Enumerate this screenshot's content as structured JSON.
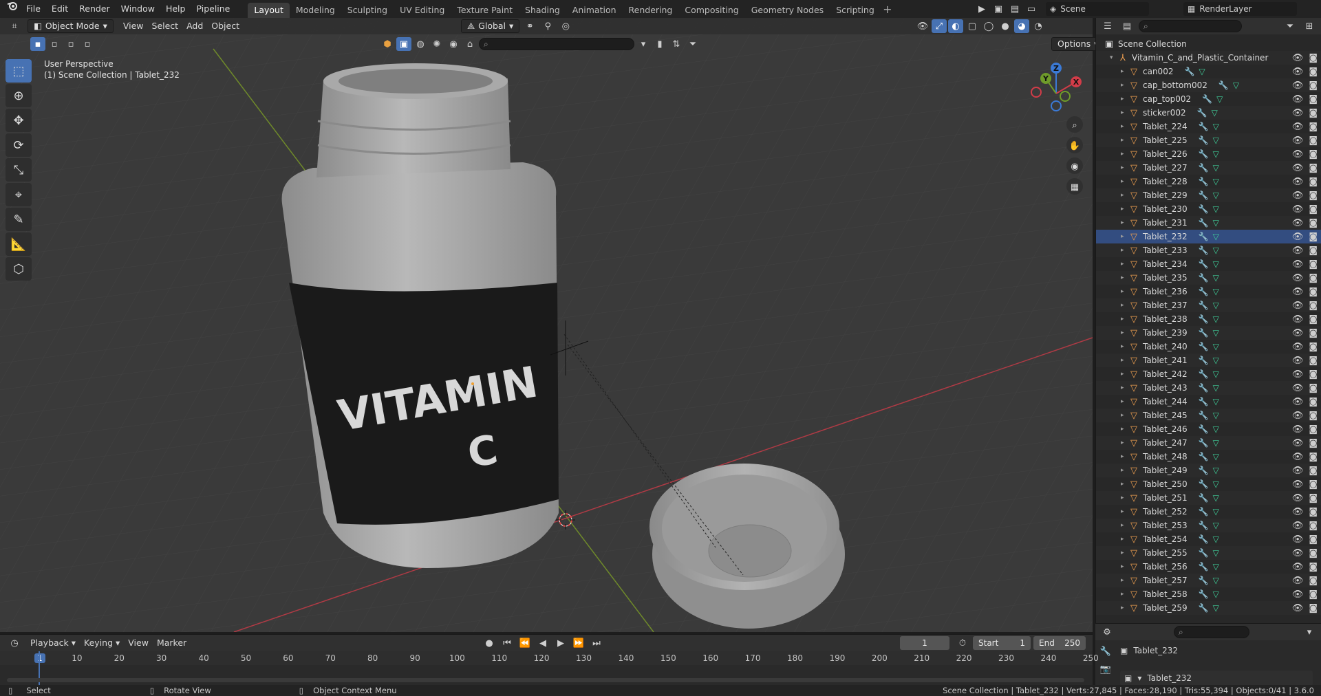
{
  "topbar": {
    "menus": [
      "File",
      "Edit",
      "Render",
      "Window",
      "Help",
      "Pipeline"
    ],
    "workspaces": [
      "Layout",
      "Modeling",
      "Sculpting",
      "UV Editing",
      "Texture Paint",
      "Shading",
      "Animation",
      "Rendering",
      "Compositing",
      "Geometry Nodes",
      "Scripting"
    ],
    "active_workspace": "Layout",
    "scene": "Scene",
    "render_layer": "RenderLayer"
  },
  "viewport": {
    "mode": "Object Mode",
    "menus": [
      "View",
      "Select",
      "Add",
      "Object"
    ],
    "orientation": "Global",
    "options_label": "Options",
    "perspective_label": "User Perspective",
    "context_label": "(1) Scene Collection | Tablet_232",
    "bottle_label_line1": "VITAMIN",
    "bottle_label_line2": "C",
    "gizmo_axes": [
      "Z",
      "Y",
      "X"
    ]
  },
  "outliner": {
    "root": "Scene Collection",
    "collection": "Vitamin_C_and_Plastic_Container",
    "items": [
      "can002",
      "cap_bottom002",
      "cap_top002",
      "sticker002",
      "Tablet_224",
      "Tablet_225",
      "Tablet_226",
      "Tablet_227",
      "Tablet_228",
      "Tablet_229",
      "Tablet_230",
      "Tablet_231",
      "Tablet_232",
      "Tablet_233",
      "Tablet_234",
      "Tablet_235",
      "Tablet_236",
      "Tablet_237",
      "Tablet_238",
      "Tablet_239",
      "Tablet_240",
      "Tablet_241",
      "Tablet_242",
      "Tablet_243",
      "Tablet_244",
      "Tablet_245",
      "Tablet_246",
      "Tablet_247",
      "Tablet_248",
      "Tablet_249",
      "Tablet_250",
      "Tablet_251",
      "Tablet_252",
      "Tablet_253",
      "Tablet_254",
      "Tablet_255",
      "Tablet_256",
      "Tablet_257",
      "Tablet_258",
      "Tablet_259"
    ],
    "selected": "Tablet_232"
  },
  "properties": {
    "object_name": "Tablet_232",
    "data_name": "Tablet_232"
  },
  "timeline": {
    "menus": [
      "Playback",
      "Keying",
      "View",
      "Marker"
    ],
    "current_frame": "1",
    "start_label": "Start",
    "start": "1",
    "end_label": "End",
    "end": "250",
    "ticks": [
      "1",
      "10",
      "20",
      "30",
      "40",
      "50",
      "60",
      "70",
      "80",
      "90",
      "100",
      "110",
      "120",
      "130",
      "140",
      "150",
      "160",
      "170",
      "180",
      "190",
      "200",
      "210",
      "220",
      "230",
      "240",
      "250"
    ]
  },
  "statusbar": {
    "select": "Select",
    "rotate": "Rotate View",
    "context_menu": "Object Context Menu",
    "stats": "Scene Collection | Tablet_232 | Verts:27,845 | Faces:28,190 | Tris:55,394 | Objects:0/41 | 3.6.0"
  }
}
